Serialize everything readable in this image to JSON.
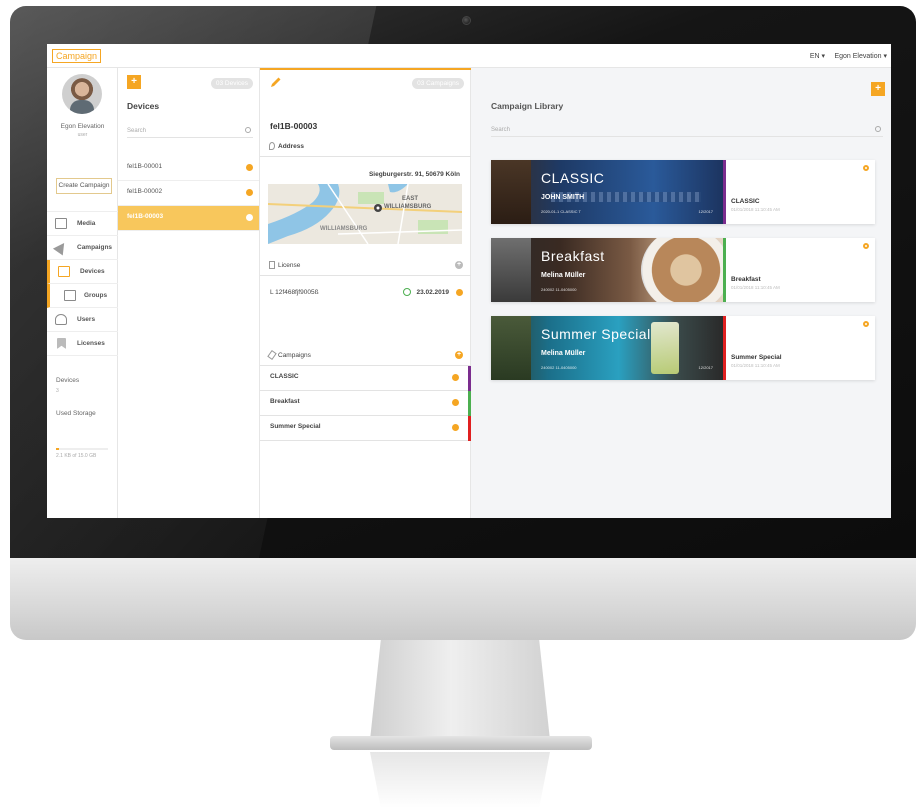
{
  "app": {
    "logo": "Campaign",
    "language": "EN ▾",
    "user_menu": "Egon Elevation ▾"
  },
  "profile": {
    "name": "Egon Elevation",
    "role": "user"
  },
  "nav": {
    "create_label": "Create Campaign",
    "items": [
      {
        "label": "Media",
        "icon": "media-icon"
      },
      {
        "label": "Campaigns",
        "icon": "paper-plane-icon"
      },
      {
        "label": "Devices",
        "icon": "monitor-icon"
      },
      {
        "label": "Groups",
        "icon": "groups-icon"
      },
      {
        "label": "Users",
        "icon": "user-icon"
      },
      {
        "label": "Licenses",
        "icon": "bookmark-icon"
      }
    ],
    "stats": {
      "devices_label": "Devices",
      "devices_value": "3",
      "storage_label": "Used Storage",
      "storage_value": "2.1 KB of 15.0 GB",
      "storage_fraction": 0.05
    }
  },
  "devices": {
    "add_label": "+",
    "count_label": "03 Devices",
    "title": "Devices",
    "search_placeholder": "Search",
    "items": [
      "fel1B-00001",
      "fel1B-00002",
      "fel1B-00003"
    ],
    "selected_index": 2
  },
  "detail": {
    "count_label": "03 Campaigns",
    "device_id": "fel1B-00003",
    "address_label": "Address",
    "address_value": "Siegburgerstr. 91, 50679 Köln",
    "map_label_east": "EAST",
    "map_label_williamsburg_east": "WILLIAMSBURG",
    "map_label_williamsburg": "WILLIAMSBURG",
    "license_label": "License",
    "license_key": "L 12f468fjf9005ß",
    "license_date": "23.02.2019",
    "campaigns_label": "Campaigns",
    "campaigns": [
      {
        "name": "CLASSIC",
        "color": "#7b2d8e"
      },
      {
        "name": "Breakfast",
        "color": "#4caf50"
      },
      {
        "name": "Summer Special",
        "color": "#e02020"
      }
    ]
  },
  "library": {
    "add_label": "+",
    "title": "Campaign Library",
    "search_placeholder": "Search",
    "cards": [
      {
        "headline": "CLASSIC",
        "person": "JOHN SMITH",
        "meta_left": "2020-01-1 CLASSIC T",
        "meta_right": "12/2017",
        "name": "CLASSIC",
        "date": "01/01/2018 11:10:45 AM",
        "accent": "#7b2d8e"
      },
      {
        "headline": "Breakfast",
        "person": "Melina Müller",
        "meta_left": "240002 11-0405000",
        "meta_right": "",
        "name": "Breakfast",
        "date": "01/01/2018 11:10:45 AM",
        "accent": "#4caf50"
      },
      {
        "headline": "Summer Special",
        "person": "Melina Müller",
        "meta_left": "240002 11-0405000",
        "meta_right": "12/2017",
        "name": "Summer Special",
        "date": "01/01/2018 11:10:45 AM",
        "accent": "#e02020"
      }
    ]
  },
  "colors": {
    "accent": "#f5a623",
    "selected_row": "#f8c75c"
  }
}
